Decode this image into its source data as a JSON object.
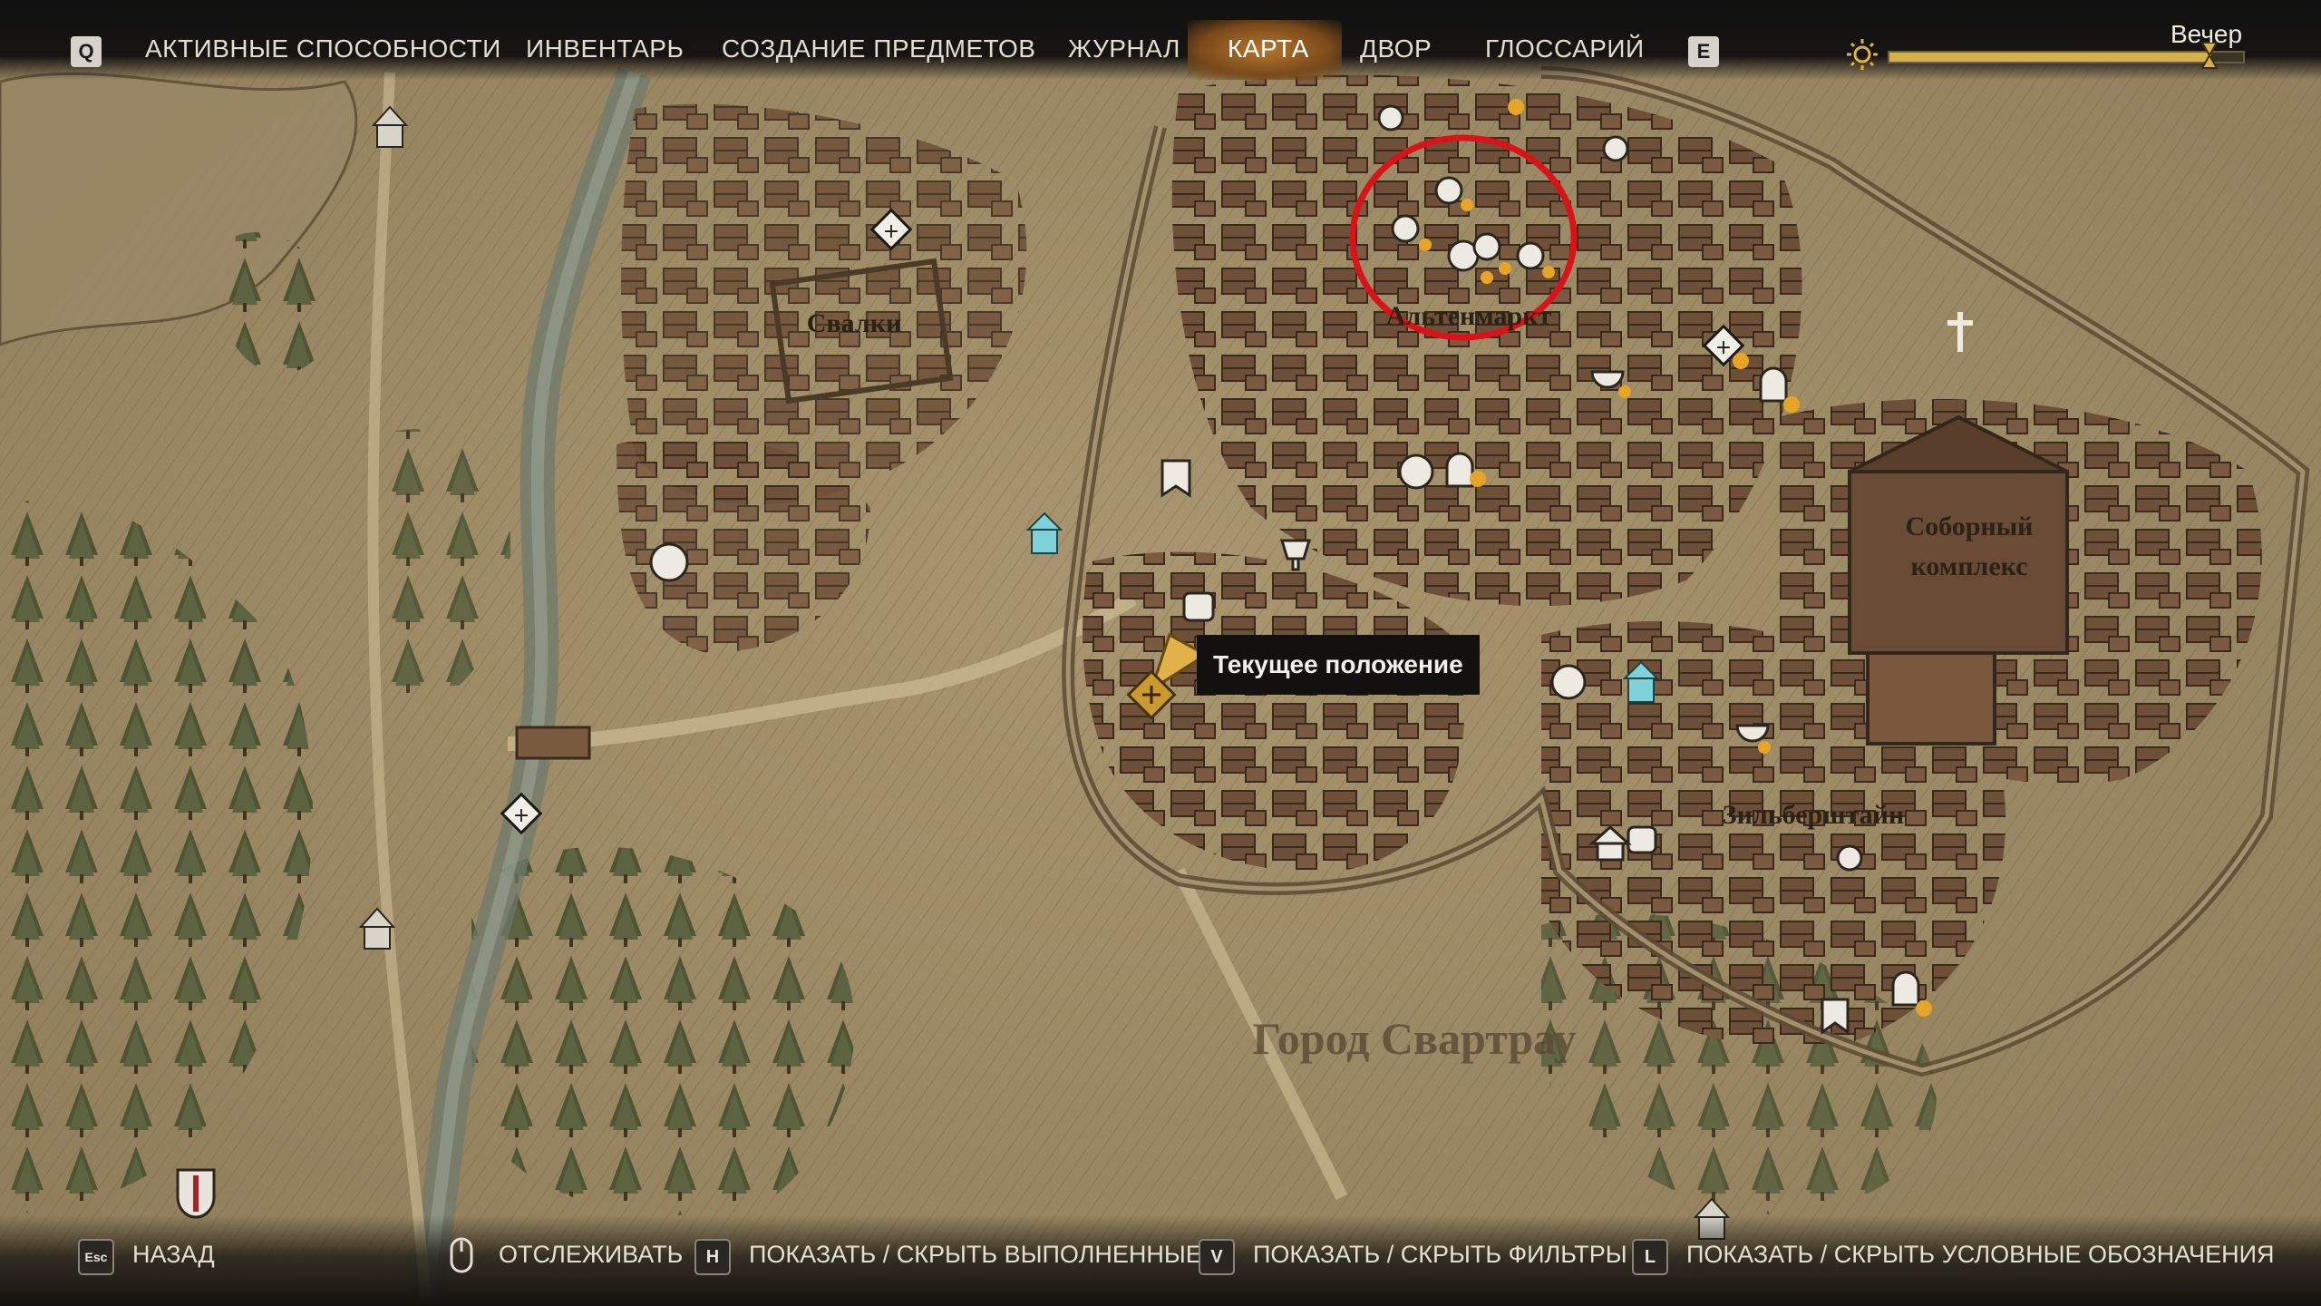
{
  "topbar": {
    "key_left": "Q",
    "key_right": "E",
    "tabs": [
      {
        "label": "АКТИВНЫЕ СПОСОБНОСТИ"
      },
      {
        "label": "ИНВЕНТАРЬ"
      },
      {
        "label": "СОЗДАНИЕ ПРЕДМЕТОВ"
      },
      {
        "label": "ЖУРНАЛ"
      },
      {
        "label": "КАРТА"
      },
      {
        "label": "ДВОР"
      },
      {
        "label": "ГЛОССАРИЙ"
      }
    ],
    "active_tab": "КАРТА",
    "time_of_day": "Вечер",
    "day_progress": 0.91
  },
  "map": {
    "labels": {
      "dumps": "Свалки",
      "altenmarkt": "Альтенмаркт",
      "cathedral": "Соборный комплекс",
      "cathedral_line1": "Соборный",
      "cathedral_line2": "комплекс",
      "silberstein": "Зильберштайн",
      "city": "Город Свартрау"
    },
    "tooltip": "Текущее положение",
    "highlight_color": "#d8141a",
    "parchment_color": "#a8956e",
    "building_color": "#6e5038",
    "forest_color": "#5b5e3c"
  },
  "bottombar": {
    "items": [
      {
        "key": "Esc",
        "label": "НАЗАД"
      },
      {
        "key": "mouse-icon",
        "label": "ОТСЛЕЖИВАТЬ"
      },
      {
        "key": "H",
        "label": "ПОКАЗАТЬ / СКРЫТЬ ВЫПОЛНЕННЫЕ"
      },
      {
        "key": "V",
        "label": "ПОКАЗАТЬ / СКРЫТЬ ФИЛЬТРЫ"
      },
      {
        "key": "L",
        "label": "ПОКАЗАТЬ / СКРЫТЬ УСЛОВНЫЕ ОБОЗНАЧЕНИЯ"
      }
    ]
  },
  "icons": {
    "sun": "sun-icon",
    "player": "player-position-icon",
    "merchant": "money-bag-icon",
    "church": "church-icon",
    "apothecary": "mortar-icon",
    "armorer": "armor-icon",
    "banner": "banner-icon",
    "quest": "diamond-quest-icon",
    "shrine": "tombstone-icon",
    "moon": "moon-icon"
  }
}
